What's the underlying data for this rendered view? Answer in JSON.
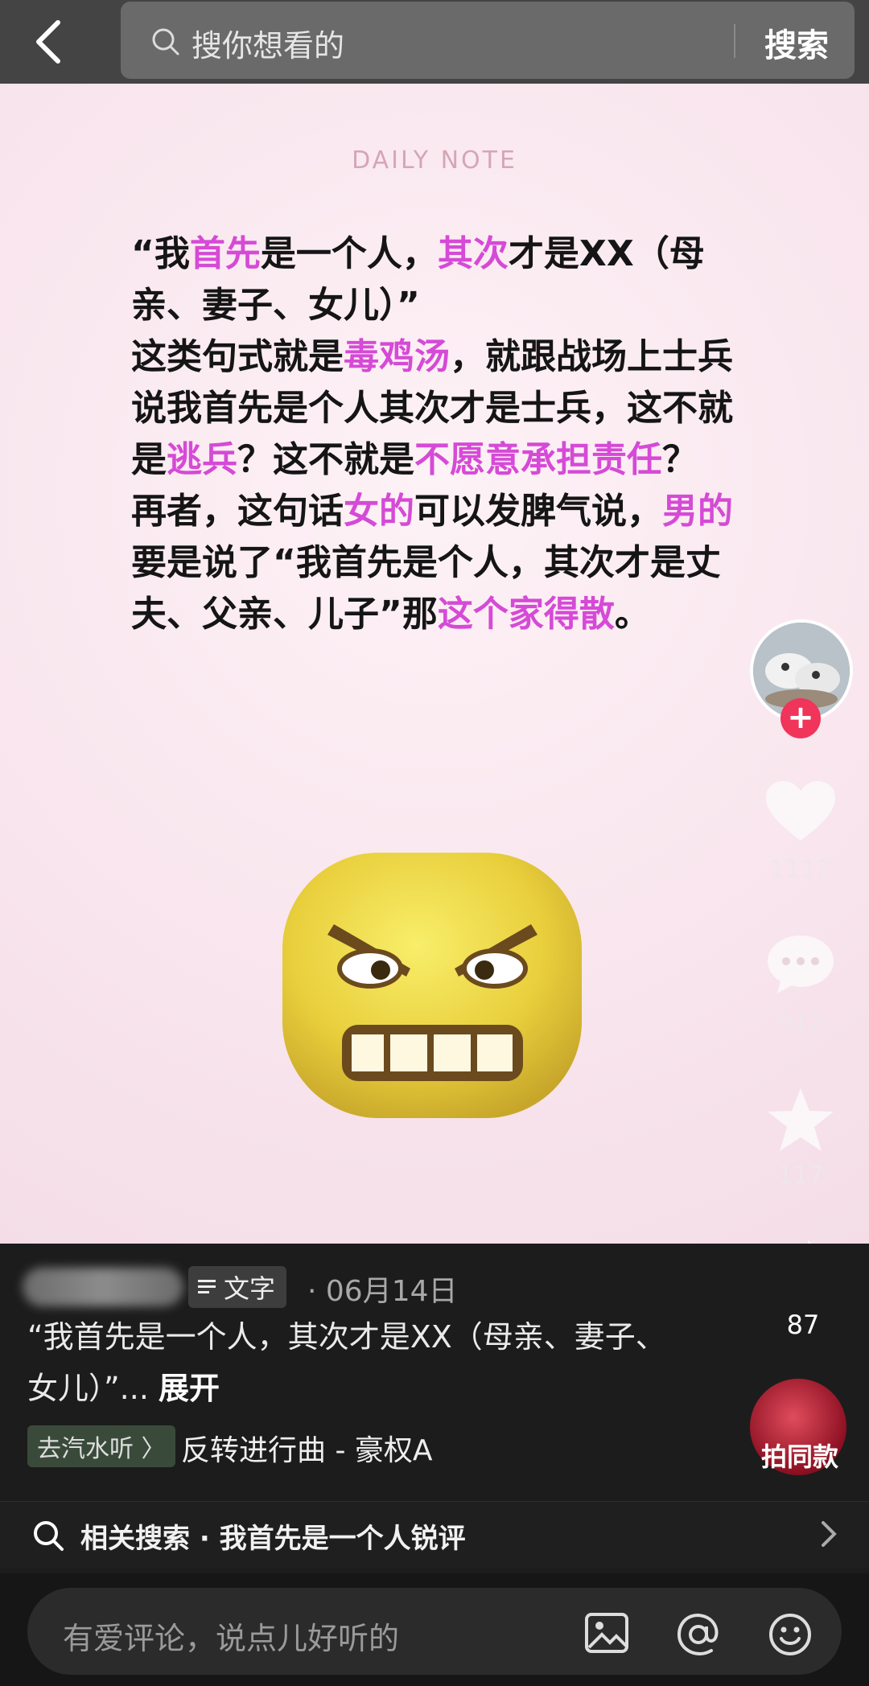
{
  "search": {
    "placeholder": "搜你想看的",
    "button_label": "搜索"
  },
  "post": {
    "header_tag": "DAILY NOTE",
    "paragraph_html_segments": [
      {
        "t": "“我",
        "h": false
      },
      {
        "t": "首先",
        "h": true
      },
      {
        "t": "是一个人，",
        "h": false
      },
      {
        "t": "其次",
        "h": true
      },
      {
        "t": "才是XX（母亲、妻子、女儿）”",
        "h": false
      },
      {
        "t": "\n",
        "h": false
      },
      {
        "t": "这类句式就是",
        "h": false
      },
      {
        "t": "毒鸡汤",
        "h": true
      },
      {
        "t": "，就跟战场上士兵说我首先是个人其次才是士兵，这不就是",
        "h": false
      },
      {
        "t": "逃兵",
        "h": true
      },
      {
        "t": "？这不就是",
        "h": false
      },
      {
        "t": "不愿意承担责任",
        "h": true
      },
      {
        "t": "？",
        "h": false
      },
      {
        "t": "\n",
        "h": false
      },
      {
        "t": "再者，这句话",
        "h": false
      },
      {
        "t": "女的",
        "h": true
      },
      {
        "t": "可以发脾气说，",
        "h": false
      },
      {
        "t": "男的",
        "h": true
      },
      {
        "t": "要是说了“我首先是个人，其次才是丈夫、父亲、儿子”那",
        "h": false
      },
      {
        "t": "这个家得散",
        "h": true
      },
      {
        "t": "。",
        "h": false
      }
    ]
  },
  "rail": {
    "likes": "1112",
    "comments": "912",
    "favorites": "117",
    "shares": "87"
  },
  "info": {
    "type_badge": "文字",
    "date": "06月14日",
    "caption": "“我首先是一个人，其次才是XX（母亲、妻子、女儿）”...",
    "expand_label": "展开",
    "music_tag": "去汽水听 〉",
    "music_title": "反转进行曲 - 豪权A",
    "same_label": "拍同款",
    "related_search": "相关搜索 · 我首先是一个人锐评"
  },
  "comment_bar": {
    "placeholder": "有爱评论，说点儿好听的"
  }
}
